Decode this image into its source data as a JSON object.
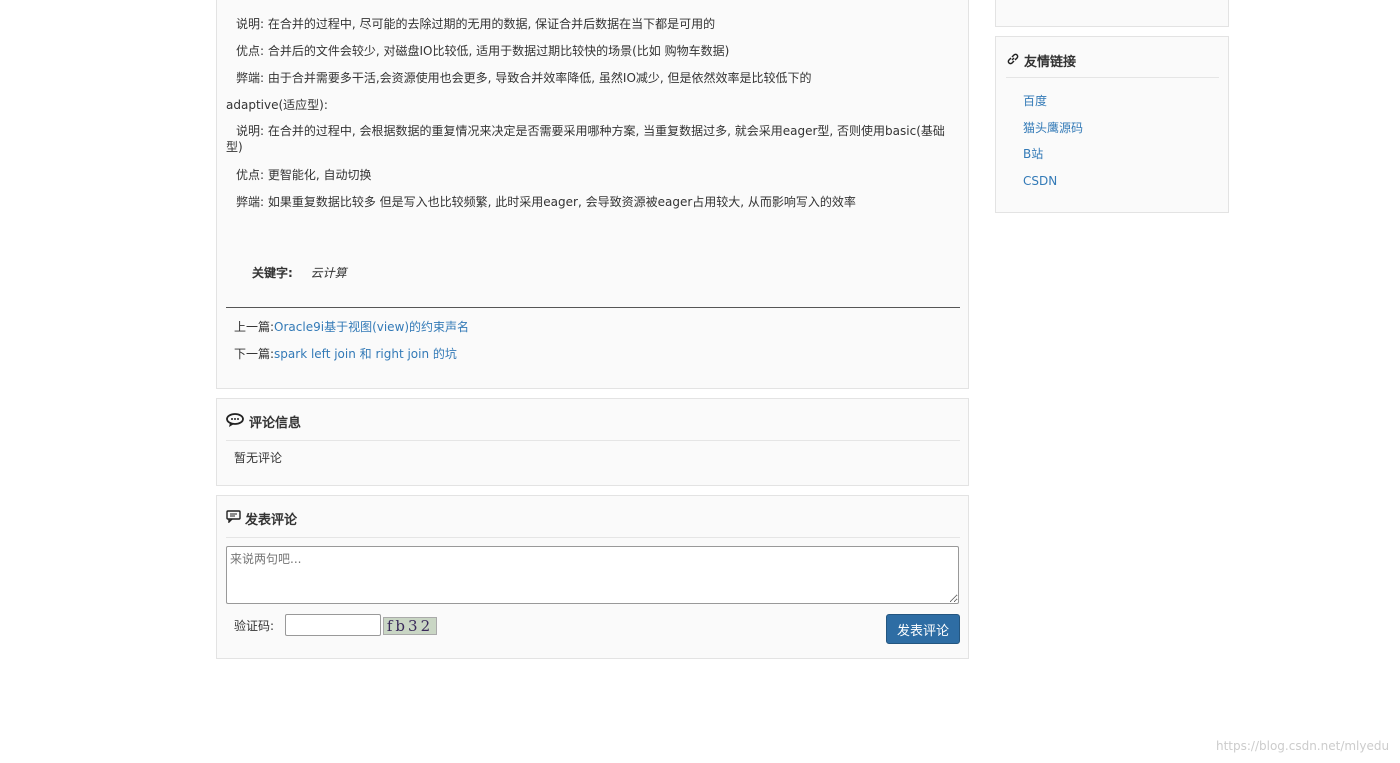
{
  "article": {
    "lines": [
      "说明: 在合并的过程中, 尽可能的去除过期的无用的数据, 保证合并后数据在当下都是可用的",
      "优点: 合并后的文件会较少, 对磁盘IO比较低, 适用于数据过期比较快的场景(比如 购物车数据)",
      "弊端: 由于合并需要多干活,会资源使用也会更多,  导致合并效率降低, 虽然IO减少, 但是依然效率是比较低下的",
      "adaptive(适应型):",
      "说明: 在合并的过程中, 会根据数据的重复情况来决定是否需要采用哪种方案, 当重复数据过多, 就会采用eager型, 否则使用basic(基础型)",
      "优点:  更智能化, 自动切换",
      "弊端: 如果重复数据比较多 但是写入也比较频繁, 此时采用eager, 会导致资源被eager占用较大, 从而影响写入的效率"
    ],
    "keyword_label": "关键字:",
    "keyword_value": "云计算",
    "prev_label": "上一篇:",
    "prev_link": "Oracle9i基于视图(view)的约束声名",
    "next_label": "下一篇:",
    "next_link": "spark left join 和 right join 的坑"
  },
  "comments": {
    "title": "评论信息",
    "empty": "暂无评论"
  },
  "post": {
    "title": "发表评论",
    "placeholder": "来说两句吧...",
    "captcha_label": "验证码:",
    "captcha_text": "fb32",
    "submit": "发表评论"
  },
  "sidebar": {
    "links_title": "友情链接",
    "links": [
      "百度",
      "猫头鹰源码",
      "B站",
      "CSDN"
    ]
  },
  "watermark": "https://blog.csdn.net/mlyedu",
  "colors": {
    "link": "#337ab7",
    "button": "#2e6da4"
  }
}
